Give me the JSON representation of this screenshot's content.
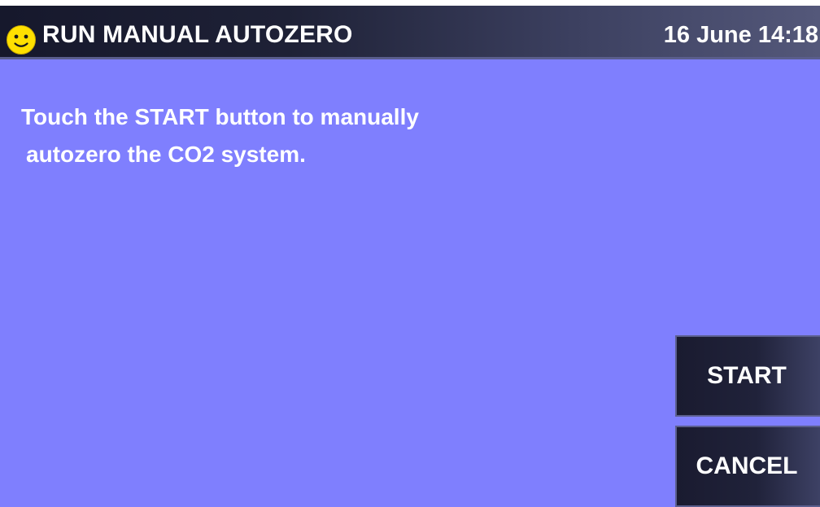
{
  "header": {
    "icon": "smiley-face-icon",
    "title": "RUN MANUAL AUTOZERO",
    "datetime": "16 June 14:18"
  },
  "main": {
    "message_line1": "Touch the START button to manually",
    "message_line2": "autozero the CO2 system."
  },
  "buttons": {
    "start_label": "START",
    "cancel_label": "CANCEL"
  },
  "colors": {
    "background": "#7f7ffe",
    "header": "#1e2136",
    "icon": "#ffe000",
    "text": "#ffffff"
  }
}
